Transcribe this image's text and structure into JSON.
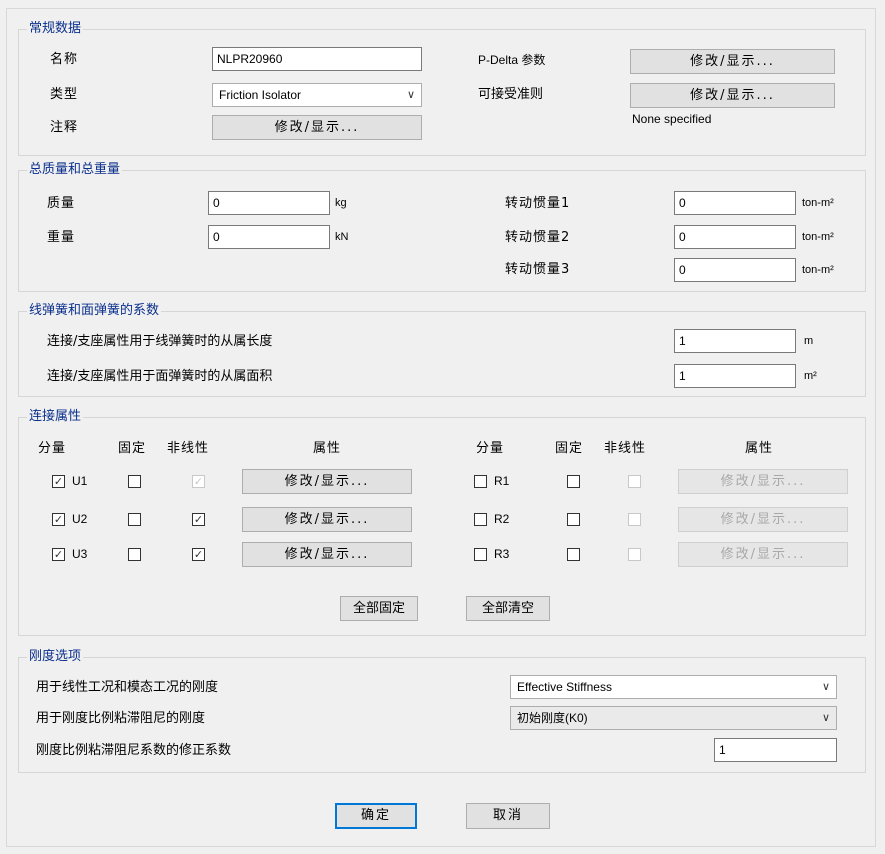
{
  "general": {
    "legend": "常规数据",
    "name_label": "名称",
    "name_value": "NLPR20960",
    "type_label": "类型",
    "type_value": "Friction Isolator",
    "notes_label": "注释",
    "notes_button": "修改/显示...",
    "pdelta_label": "P-Delta 参数",
    "pdelta_button": "修改/显示...",
    "acceptance_label": "可接受准则",
    "acceptance_button": "修改/显示...",
    "acceptance_status": "None specified"
  },
  "mass": {
    "legend": "总质量和总重量",
    "mass_label": "质量",
    "mass_value": "0",
    "mass_unit": "kg",
    "weight_label": "重量",
    "weight_value": "0",
    "weight_unit": "kN",
    "rot1_label": "转动惯量1",
    "rot1_value": "0",
    "rot2_label": "转动惯量2",
    "rot2_value": "0",
    "rot3_label": "转动惯量3",
    "rot3_value": "0",
    "rot_unit": "ton-m²"
  },
  "springs": {
    "legend": "线弹簧和面弹簧的系数",
    "line_label": "连接/支座属性用于线弹簧时的从属长度",
    "line_value": "1",
    "line_unit": "m",
    "area_label": "连接/支座属性用于面弹簧时的从属面积",
    "area_value": "1",
    "area_unit": "m²"
  },
  "props": {
    "legend": "连接属性",
    "hdr_dir": "分量",
    "hdr_fixed": "固定",
    "hdr_nonlinear": "非线性",
    "hdr_props": "属性",
    "rows_left": [
      {
        "dir": "U1",
        "dir_checked": "✓",
        "fixed": "",
        "nonlinear": "✓",
        "button": "修改/显示..."
      },
      {
        "dir": "U2",
        "dir_checked": "✓",
        "fixed": "",
        "nonlinear": "✓",
        "button": "修改/显示..."
      },
      {
        "dir": "U3",
        "dir_checked": "✓",
        "fixed": "",
        "nonlinear": "✓",
        "button": "修改/显示..."
      }
    ],
    "rows_right": [
      {
        "dir": "R1",
        "dir_checked": "",
        "fixed": "",
        "nonlinear": "",
        "button": "修改/显示..."
      },
      {
        "dir": "R2",
        "dir_checked": "",
        "fixed": "",
        "nonlinear": "",
        "button": "修改/显示..."
      },
      {
        "dir": "R3",
        "dir_checked": "",
        "fixed": "",
        "nonlinear": "",
        "button": "修改/显示..."
      }
    ],
    "fix_all": "全部固定",
    "clear_all": "全部清空"
  },
  "stiffness": {
    "legend": "刚度选项",
    "linear_label": "用于线性工况和模态工况的刚度",
    "linear_value": "Effective Stiffness",
    "damping_label": "用于刚度比例粘滞阻尼的刚度",
    "damping_value": "初始刚度(K0)",
    "factor_label": "刚度比例粘滞阻尼系数的修正系数",
    "factor_value": "1"
  },
  "footer": {
    "ok": "确定",
    "cancel": "取消"
  }
}
